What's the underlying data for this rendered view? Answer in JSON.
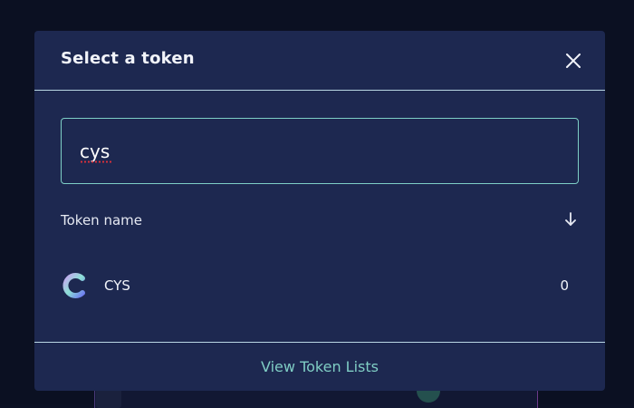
{
  "modal": {
    "title": "Select a token",
    "close_icon": "close-icon"
  },
  "search": {
    "value": "cys",
    "placeholder": ""
  },
  "list_header": {
    "label": "Token name",
    "sort_icon": "arrow-down-icon"
  },
  "tokens": [
    {
      "symbol": "CYS",
      "balance": "0",
      "icon": "cys-token-logo"
    }
  ],
  "footer": {
    "link_label": "View Token Lists"
  },
  "colors": {
    "backdrop": "#0b1022",
    "modal_bg": "#1d2850",
    "divider": "#b9d6e3",
    "accent": "#7ecfc6",
    "text": "#f2f4fa"
  }
}
